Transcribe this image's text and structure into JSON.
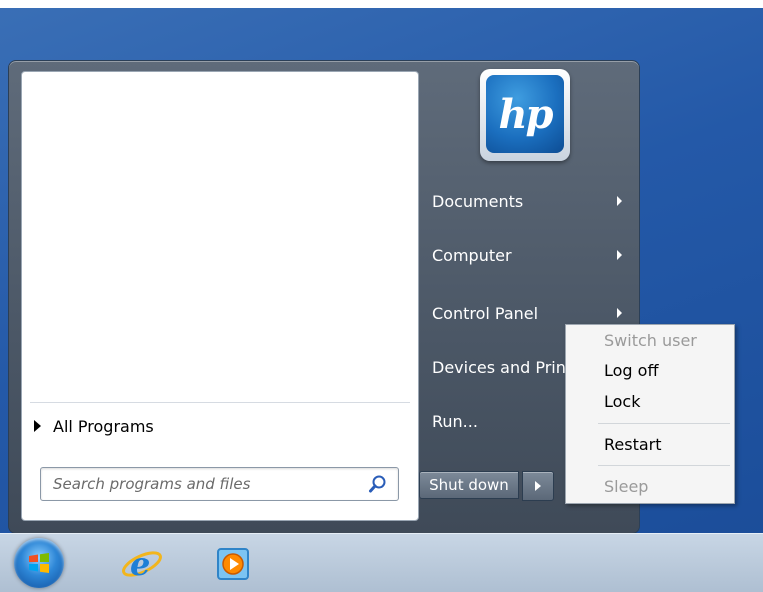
{
  "start_menu": {
    "all_programs_label": "All Programs",
    "search": {
      "placeholder": "Search programs and files"
    },
    "user_tile_logo": "hp",
    "right_items": [
      {
        "label": "Documents",
        "has_arrow": true
      },
      {
        "label": "Computer",
        "has_arrow": true
      },
      {
        "label": "Control Panel",
        "has_arrow": true
      },
      {
        "label": "Devices and Prin",
        "has_arrow": false
      },
      {
        "label": "Run...",
        "has_arrow": false
      }
    ],
    "shutdown_label": "Shut down"
  },
  "shutdown_menu": {
    "items": [
      {
        "label": "Switch user",
        "enabled": false
      },
      {
        "label": "Log off",
        "enabled": true
      },
      {
        "label": "Lock",
        "enabled": true
      },
      {
        "label": "Restart",
        "enabled": true
      },
      {
        "label": "Sleep",
        "enabled": false
      }
    ]
  },
  "taskbar": {
    "icons": [
      "start-orb-icon",
      "internet-explorer-icon",
      "windows-media-player-icon"
    ]
  },
  "colors": {
    "desktop": "#2459a8",
    "hp_blue": "#1b6fbf"
  }
}
